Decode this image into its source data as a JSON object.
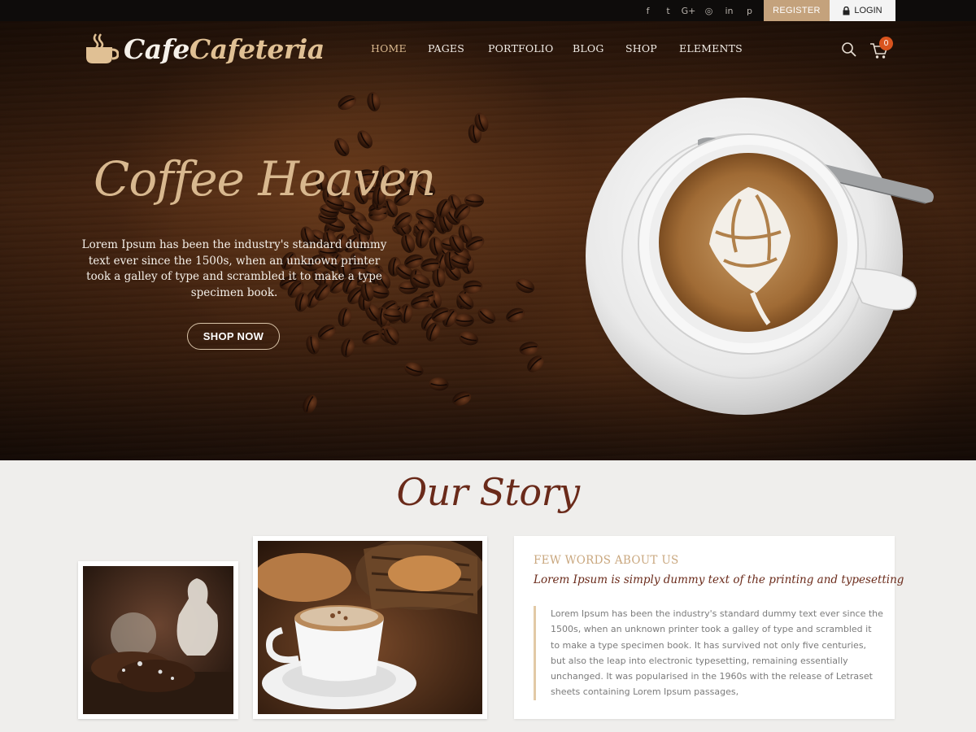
{
  "topbar": {
    "social_icons": [
      "facebook-icon",
      "twitter-icon",
      "google-plus-icon",
      "instagram-icon",
      "linkedin-icon",
      "pinterest-icon"
    ],
    "social_glyphs": [
      "f",
      "t",
      "G+",
      "◎",
      "in",
      "p"
    ],
    "register_label": "REGISTER",
    "login_label": "LOGIN"
  },
  "header": {
    "logo_part1": "Cafe",
    "logo_part2": "Cafeteria",
    "nav": [
      {
        "label": "HOME",
        "active": true
      },
      {
        "label": "PAGES",
        "active": false
      },
      {
        "label": "PORTFOLIO",
        "active": false
      },
      {
        "label": "BLOG",
        "active": false
      },
      {
        "label": "SHOP",
        "active": false
      },
      {
        "label": "ELEMENTS",
        "active": false
      }
    ],
    "cart_count": "0"
  },
  "hero": {
    "title": "Coffee Heaven",
    "text": "Lorem Ipsum has been the industry's standard dummy text ever since the 1500s, when an unknown printer took a galley of type and scrambled it to make a type specimen book.",
    "button_label": "SHOP NOW"
  },
  "story": {
    "title": "Our Story",
    "about_heading": "FEW WORDS ABOUT US",
    "about_subheading": "Lorem Ipsum is simply dummy text of the printing and typesetting",
    "about_text": "Lorem Ipsum has been the industry's standard dummy text ever since the 1500s, when an unknown printer took a galley of type and scrambled it to make a type specimen book. It has survived not only five centuries, but also the leap into electronic typesetting, remaining essentially unchanged. It was popularised in the 1960s with the release of Letraset sheets containing Lorem Ipsum passages,"
  },
  "colors": {
    "accent": "#c4a27c",
    "heading_brown": "#6a2a1a",
    "cart_badge": "#d9541e"
  }
}
